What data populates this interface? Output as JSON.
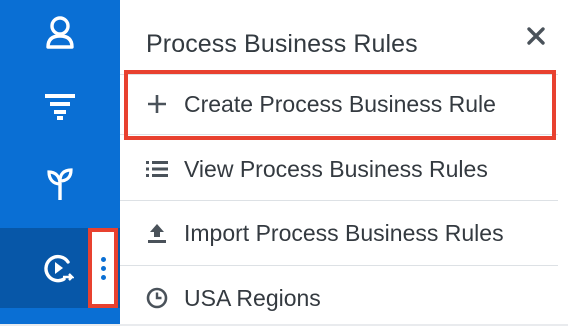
{
  "menu": {
    "header": "Process Business Rules",
    "items": [
      {
        "label": "Create Process Business Rule",
        "icon": "plus-icon",
        "highlighted": true
      },
      {
        "label": "View Process Business Rules",
        "icon": "list-icon"
      },
      {
        "label": "Import Process Business Rules",
        "icon": "upload-icon"
      },
      {
        "label": "USA Regions",
        "icon": "clock-icon"
      }
    ]
  },
  "sidebar": {
    "items": [
      {
        "icon": "contacts-icon"
      },
      {
        "icon": "filter-icon"
      },
      {
        "icon": "opportunities-icon"
      },
      {
        "icon": "process-business-rules-icon",
        "active": true
      }
    ]
  },
  "colors": {
    "sidebar": "#0a6fd4",
    "sidebar_active": "#0757a8",
    "highlight_border": "#e8412f",
    "text": "#343a40"
  }
}
